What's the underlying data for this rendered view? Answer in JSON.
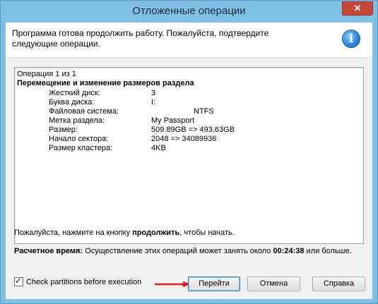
{
  "window": {
    "title": "Отложенные операции",
    "close_symbol": "✕"
  },
  "header": {
    "message": "Программа готова продолжить работу. Пожалуйста, подтвердите следующие операции.",
    "icon": "info-icon",
    "icon_glyph": "i"
  },
  "details": {
    "count": "Операция 1 из 1",
    "title": "Перемещение и изменение размеров раздела",
    "rows": [
      {
        "label": "Жесткий диск:",
        "value": "3"
      },
      {
        "label": "Буква диска:",
        "value": "I:"
      },
      {
        "label": "Файловая система:",
        "value": "NTFS"
      },
      {
        "label": "Метка раздела:",
        "value": "My Passport"
      },
      {
        "label": "Размер:",
        "value": "509.89GB => 493.63GB"
      },
      {
        "label": "Начало сектора:",
        "value": "2048 => 34089936"
      },
      {
        "label": "Размер кластера:",
        "value": "4KB"
      }
    ]
  },
  "continue_note": {
    "before": "Пожалуйста, нажмите на кнопку ",
    "emphasis": "продолжить",
    "after": ", чтобы начать."
  },
  "estimate": {
    "label": "Расчетное время:",
    "text_before": " Осуществление этих операций может занять около ",
    "time": "00:24:38",
    "text_after": " или больше."
  },
  "check_partitions": {
    "label": "Check partitions before execution",
    "checked": true,
    "check_glyph": "✓"
  },
  "buttons": {
    "proceed": "Перейти",
    "cancel": "Отмена",
    "help": "Справка"
  },
  "colors": {
    "frame": "#7ebfe3",
    "arrow": "#e01b1b"
  }
}
